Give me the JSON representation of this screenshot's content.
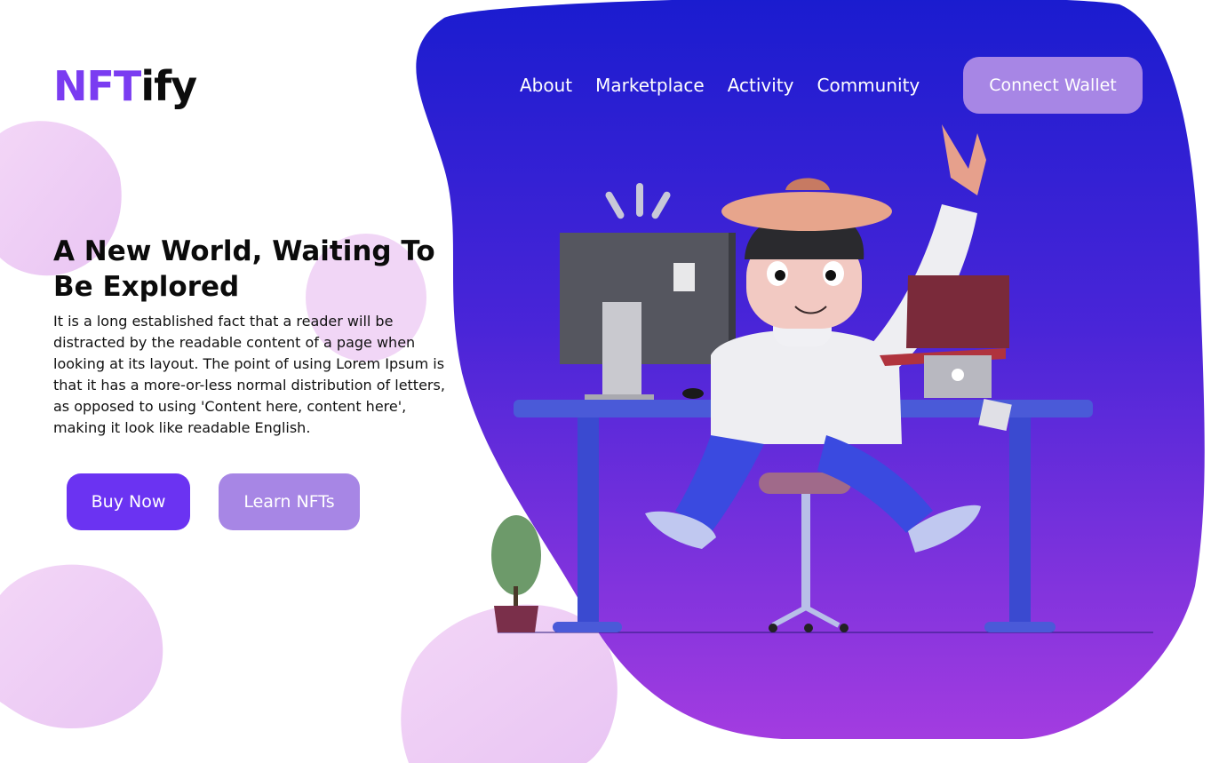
{
  "brand": {
    "part1": "NFT",
    "part2": "ify"
  },
  "nav": {
    "items": [
      {
        "label": "About"
      },
      {
        "label": "Marketplace"
      },
      {
        "label": "Activity"
      },
      {
        "label": "Community"
      }
    ],
    "connect_label": "Connect Wallet"
  },
  "hero": {
    "title": "A New World, Waiting To Be Explored",
    "body": "It is a long established fact that a reader will be distracted by the readable content of a page when looking at its layout. The point of using Lorem Ipsum is that it has a more-or-less normal distribution of letters, as opposed to using 'Content here, content here', making it look like readable English.",
    "buy_label": "Buy Now",
    "learn_label": "Learn NFTs"
  },
  "colors": {
    "brand_purple": "#7a3cf1",
    "button_primary": "#6b33f2",
    "button_secondary": "#a786e5",
    "blob_top": "#1b1fd4",
    "blob_bottom": "#a437e0",
    "bubble": "#f1d3f6"
  },
  "illustration": {
    "icon": "developer-at-desk-illustration"
  }
}
